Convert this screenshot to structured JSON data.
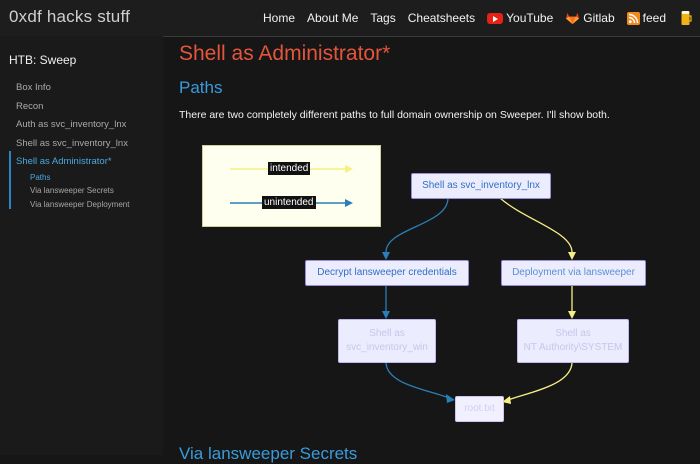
{
  "header": {
    "brand": "0xdf hacks stuff",
    "nav": [
      "Home",
      "About Me",
      "Tags",
      "Cheatsheets",
      "YouTube",
      "Gitlab",
      "feed"
    ]
  },
  "sidebar": {
    "title": "HTB: Sweep",
    "items": [
      "Box Info",
      "Recon",
      "Auth as svc_inventory_lnx",
      "Shell as svc_inventory_lnx",
      "Shell as Administrator*"
    ],
    "subitems": [
      "Paths",
      "Via lansweeper Secrets",
      "Via lansweeper Deployment"
    ]
  },
  "main": {
    "title": "Shell as Administrator*",
    "section1": "Paths",
    "intro": "There are two completely different paths to full domain ownership on Sweeper. I'll show both.",
    "section2": "Via lansweeper Secrets"
  },
  "diagram": {
    "legend": {
      "intended": "intended",
      "unintended": "unintended"
    },
    "nodes": {
      "start": "Shell as svc_inventory_lnx",
      "decrypt": "Decrypt lansweeper credentials",
      "deploy": "Deployment via lansweeper",
      "shell_win_l1": "Shell as",
      "shell_win_l2": "svc_inventory_win",
      "shell_nt_l1": "Shell as",
      "shell_nt_l2": "NT Authority\\SYSTEM",
      "root": "root.txt"
    }
  },
  "colors": {
    "intended": "#f6f083",
    "unintended": "#2a7fb8",
    "title": "#e5553b",
    "heading": "#3a9bdc"
  }
}
